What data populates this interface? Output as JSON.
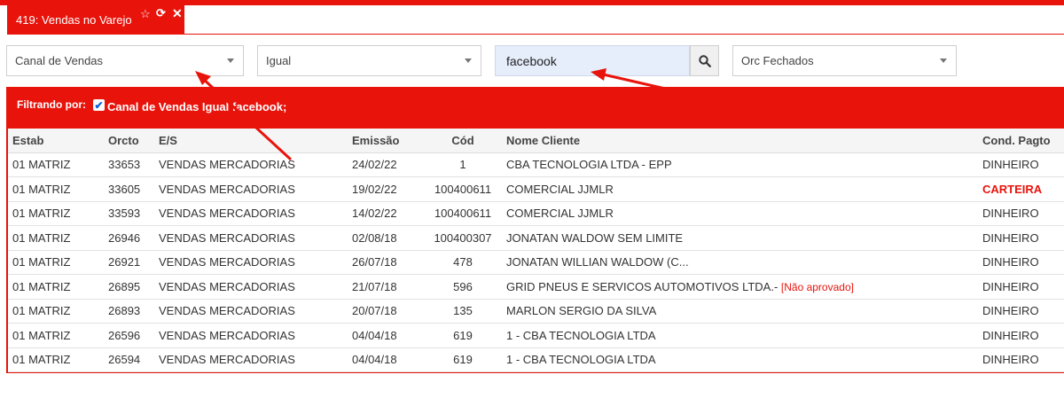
{
  "tab": {
    "title": "419: Vendas no Varejo",
    "icons": [
      "star-icon",
      "refresh-icon",
      "close-icon"
    ]
  },
  "filters": {
    "field": "Canal de Vendas",
    "operator": "Igual",
    "search_value": "facebook",
    "status": "Orc Fechados"
  },
  "filterbar": {
    "label": "Filtrando por:",
    "active_filter": "Canal de Vendas Igual facebook;",
    "checked": true
  },
  "table": {
    "columns": [
      "Estab",
      "Orcto",
      "E/S",
      "Emissão",
      "Cód",
      "Nome Cliente",
      "Cond. Pagto"
    ],
    "rows": [
      {
        "estab": "01 MATRIZ",
        "orcto": "33653",
        "es": "VENDAS MERCADORIAS",
        "emissao": "24/02/22",
        "cod": "1",
        "cliente": "CBA TECNOLOGIA LTDA - EPP",
        "tag": "",
        "cond": "DINHEIRO"
      },
      {
        "estab": "01 MATRIZ",
        "orcto": "33605",
        "es": "VENDAS MERCADORIAS",
        "emissao": "19/02/22",
        "cod": "100400611",
        "cliente": "COMERCIAL JJMLR",
        "tag": "",
        "cond": "CARTEIRA"
      },
      {
        "estab": "01 MATRIZ",
        "orcto": "33593",
        "es": "VENDAS MERCADORIAS",
        "emissao": "14/02/22",
        "cod": "100400611",
        "cliente": "COMERCIAL JJMLR",
        "tag": "",
        "cond": "DINHEIRO"
      },
      {
        "estab": "01 MATRIZ",
        "orcto": "26946",
        "es": "VENDAS MERCADORIAS",
        "emissao": "02/08/18",
        "cod": "100400307",
        "cliente": "JONATAN WALDOW SEM LIMITE",
        "tag": "",
        "cond": "DINHEIRO"
      },
      {
        "estab": "01 MATRIZ",
        "orcto": "26921",
        "es": "VENDAS MERCADORIAS",
        "emissao": "26/07/18",
        "cod": "478",
        "cliente": "JONATAN WILLIAN WALDOW (C...",
        "tag": "",
        "cond": "DINHEIRO"
      },
      {
        "estab": "01 MATRIZ",
        "orcto": "26895",
        "es": "VENDAS MERCADORIAS",
        "emissao": "21/07/18",
        "cod": "596",
        "cliente": "GRID PNEUS E SERVICOS AUTOMOTIVOS LTDA.-",
        "tag": "[Não aprovado]",
        "cond": "DINHEIRO"
      },
      {
        "estab": "01 MATRIZ",
        "orcto": "26893",
        "es": "VENDAS MERCADORIAS",
        "emissao": "20/07/18",
        "cod": "135",
        "cliente": "MARLON SERGIO DA SILVA",
        "tag": "",
        "cond": "DINHEIRO"
      },
      {
        "estab": "01 MATRIZ",
        "orcto": "26596",
        "es": "VENDAS MERCADORIAS",
        "emissao": "04/04/18",
        "cod": "619",
        "cliente": "1 - CBA TECNOLOGIA LTDA",
        "tag": "",
        "cond": "DINHEIRO"
      },
      {
        "estab": "01 MATRIZ",
        "orcto": "26594",
        "es": "VENDAS MERCADORIAS",
        "emissao": "04/04/18",
        "cod": "619",
        "cliente": "1 - CBA TECNOLOGIA LTDA",
        "tag": "",
        "cond": "DINHEIRO"
      }
    ]
  },
  "colors": {
    "accent": "#e8140c",
    "search_bg": "#e6eefc"
  }
}
